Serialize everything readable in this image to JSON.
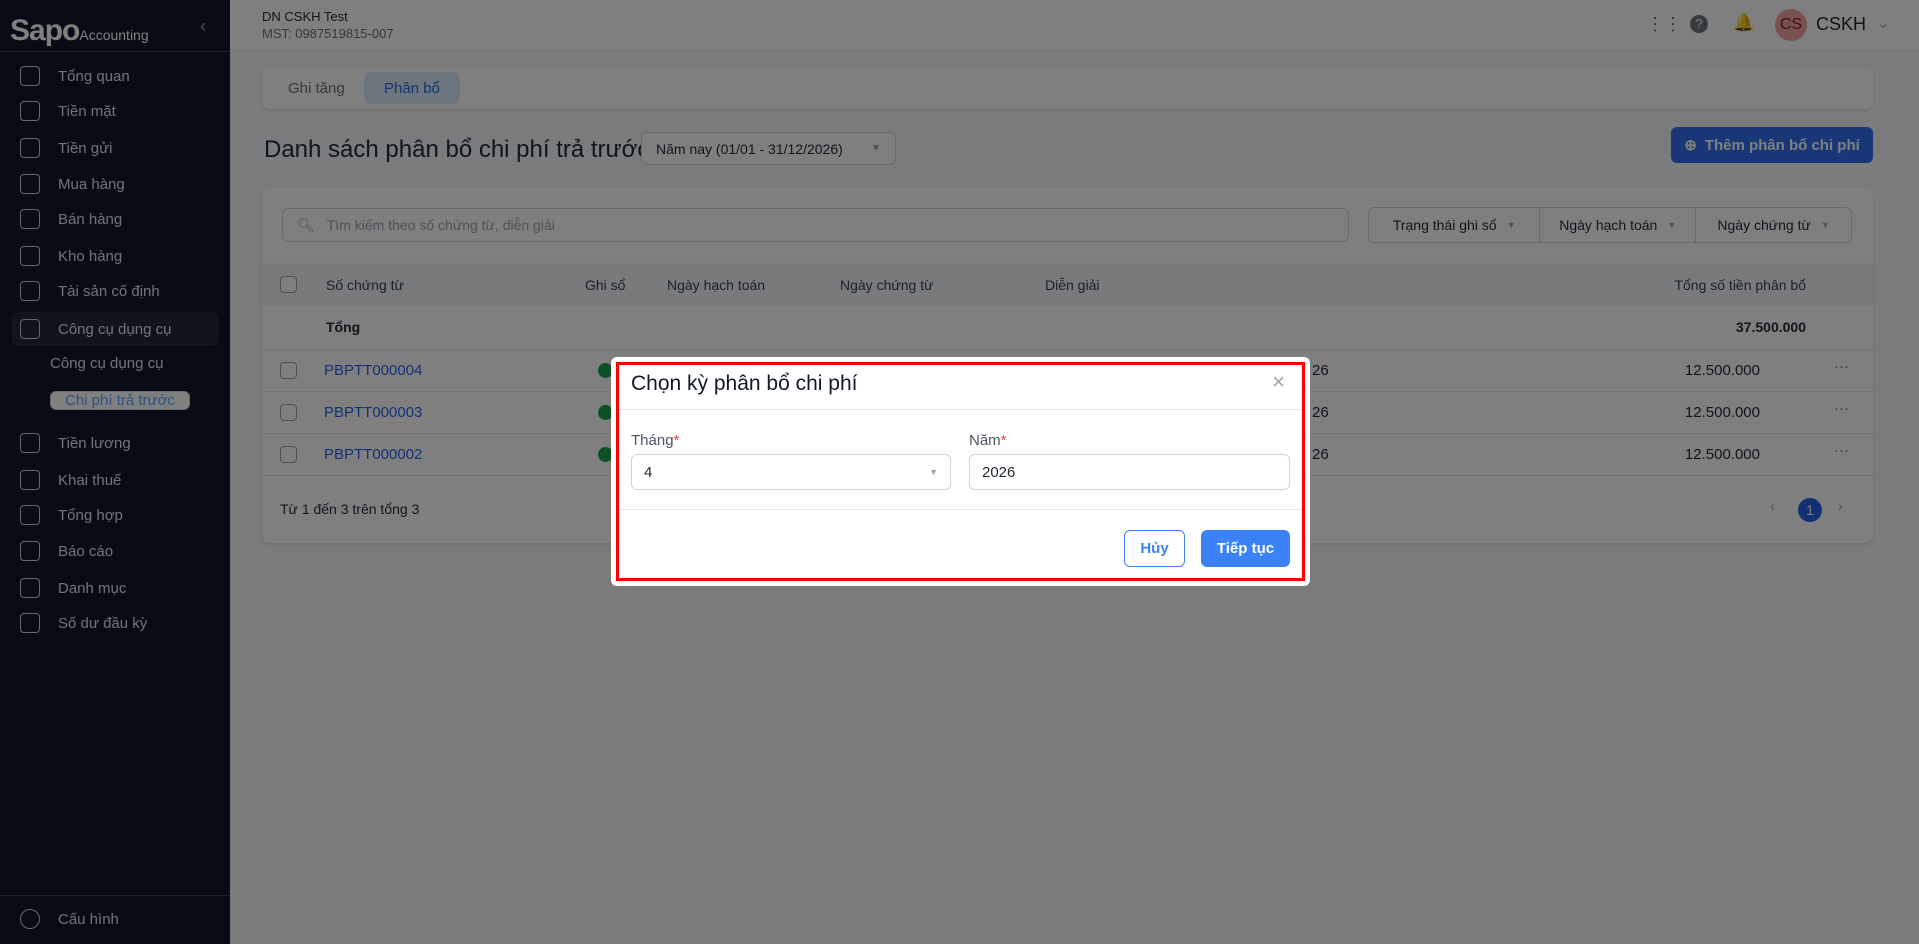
{
  "brand": {
    "logo": "Sapo",
    "sub": "Accounting"
  },
  "company": {
    "name": "DN CSKH Test",
    "tax": "MST: 0987519815-007"
  },
  "user": {
    "initials": "CS",
    "name": "CSKH"
  },
  "sidebar": {
    "items": [
      {
        "label": "Tổng quan"
      },
      {
        "label": "Tiền mặt"
      },
      {
        "label": "Tiền gửi"
      },
      {
        "label": "Mua hàng"
      },
      {
        "label": "Bán hàng"
      },
      {
        "label": "Kho hàng"
      },
      {
        "label": "Tài sản cố định"
      },
      {
        "label": "Công cụ dụng cụ"
      }
    ],
    "sub": [
      {
        "label": "Công cụ dụng cụ"
      },
      {
        "label": "Chi phí trả trước"
      }
    ],
    "items2": [
      {
        "label": "Tiền lương"
      },
      {
        "label": "Khai thuế"
      },
      {
        "label": "Tổng hợp"
      },
      {
        "label": "Báo cáo"
      },
      {
        "label": "Danh mục"
      },
      {
        "label": "Số dư đầu kỳ"
      }
    ],
    "settings": "Cấu hình"
  },
  "tabs": [
    {
      "label": "Ghi tăng"
    },
    {
      "label": "Phân bổ"
    }
  ],
  "page": {
    "title": "Danh sách phân bổ chi phí trả trước",
    "period": "Năm nay (01/01 - 31/12/2026)",
    "add": "Thêm phân bổ chi phí"
  },
  "search": {
    "placeholder": "Tìm kiếm theo số chứng từ, diễn giải"
  },
  "filters": [
    "Trạng thái ghi sổ",
    "Ngày hạch toán",
    "Ngày chứng từ"
  ],
  "table": {
    "headers": [
      "Số chứng từ",
      "Ghi sổ",
      "Ngày hạch toán",
      "Ngày chứng từ",
      "Diễn giải",
      "Tổng số tiền phân bổ"
    ],
    "total_label": "Tổng",
    "total": "37.500.000",
    "rows": [
      {
        "no": "PBPTT000004",
        "date_tail": "26",
        "amount": "12.500.000"
      },
      {
        "no": "PBPTT000003",
        "date_tail": "26",
        "amount": "12.500.000"
      },
      {
        "no": "PBPTT000002",
        "date_tail": "26",
        "amount": "12.500.000"
      }
    ]
  },
  "pagination": {
    "summary": "Từ 1 đến 3 trên tổng 3",
    "page": "1"
  },
  "modal": {
    "title": "Chọn kỳ phân bổ chi phí",
    "month_label": "Tháng",
    "month": "4",
    "year_label": "Năm",
    "year": "2026",
    "cancel": "Hủy",
    "ok": "Tiếp tục"
  }
}
